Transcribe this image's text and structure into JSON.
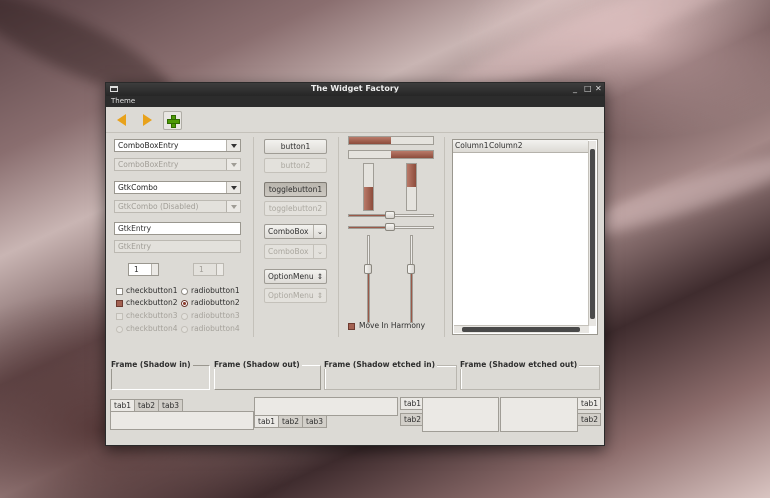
{
  "window": {
    "title": "The Widget Factory"
  },
  "menubar": {
    "items": [
      "Theme"
    ]
  },
  "toolbar": {
    "back_icon": "go-back-icon",
    "forward_icon": "go-forward-icon",
    "add_icon": "add-icon"
  },
  "col1": {
    "combo_entry": "ComboBoxEntry",
    "combo_entry_disabled": "ComboBoxEntry",
    "gtk_combo": "GtkCombo",
    "gtk_combo_disabled": "GtkCombo (Disabled)",
    "entry": "GtkEntry",
    "entry_disabled": "GtkEntry",
    "spin_value": "1",
    "spin_value_disabled": "1",
    "checks": [
      "checkbutton1",
      "checkbutton2",
      "checkbutton3",
      "checkbutton4"
    ],
    "radios": [
      "radiobutton1",
      "radiobutton2",
      "radiobutton3",
      "radiobutton4"
    ]
  },
  "col2": {
    "button1": "button1",
    "button2": "button2",
    "toggle1": "togglebutton1",
    "toggle2": "togglebutton2",
    "combobox": "ComboBox",
    "combobox_disabled": "ComboBox",
    "optionmenu": "OptionMenu",
    "optionmenu_disabled": "OptionMenu"
  },
  "col3": {
    "progress": {
      "h1": 0.5,
      "h2": 0.5,
      "v1": 0.5,
      "v2": 0.5
    },
    "scales": {
      "h1": 0.5,
      "h2": 0.5,
      "v1": 0.4,
      "v2": 0.4
    },
    "harmony_label": "Move In Harmony",
    "harmony_checked": true
  },
  "tree": {
    "columns": [
      "Column1",
      "Column2"
    ]
  },
  "frames": [
    "Frame (Shadow in)",
    "Frame (Shadow out)",
    "Frame (Shadow etched in)",
    "Frame (Shadow etched out)"
  ],
  "notebooks": {
    "tabs": [
      "tab1",
      "tab2",
      "tab3"
    ]
  }
}
